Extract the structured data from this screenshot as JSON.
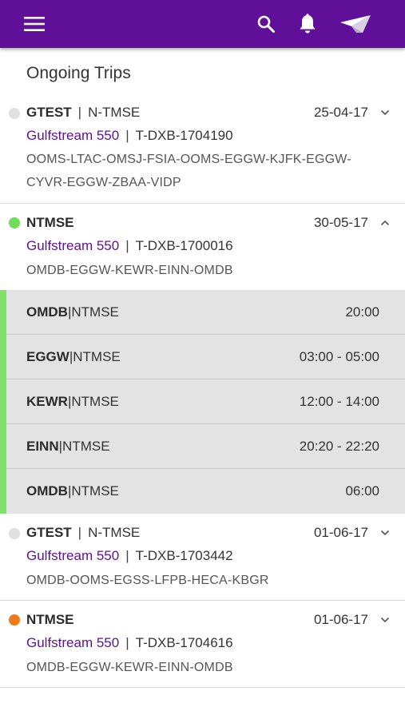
{
  "header": {
    "icons": [
      "menu-icon",
      "search-icon",
      "bell-icon",
      "paper-plane-icon"
    ],
    "background": "#5f0f98"
  },
  "section_title": "Ongoing Trips",
  "trips": [
    {
      "status_color": "#e0e0e0",
      "tail": "GTEST",
      "registration": "N-TMSE",
      "date": "25-04-17",
      "aircraft": "Gulfstream 550",
      "trip_id": "T-DXB-1704190",
      "route_line1": "OOMS-LTAC-OMSJ-FSIA-OOMS-EGGW-KJFK-EGGW-",
      "route_line2": "CYVR-EGGW-ZBAA-VIDP",
      "expanded": false
    },
    {
      "status_color": "#6fdc5a",
      "tail": "NTMSE",
      "registration": "",
      "date": "30-05-17",
      "aircraft": "Gulfstream 550",
      "trip_id": "T-DXB-1700016",
      "route_line1": "OMDB-EGGW-KEWR-EINN-OMDB",
      "expanded": true,
      "legs": [
        {
          "airport": "OMDB",
          "tail": "NTMSE",
          "time": "20:00"
        },
        {
          "airport": "EGGW",
          "tail": "NTMSE",
          "time": "03:00 - 05:00"
        },
        {
          "airport": "KEWR",
          "tail": "NTMSE",
          "time": "12:00 - 14:00"
        },
        {
          "airport": "EINN",
          "tail": "NTMSE",
          "time": "20:20 - 22:20"
        },
        {
          "airport": "OMDB",
          "tail": "NTMSE",
          "time": "06:00"
        }
      ]
    },
    {
      "status_color": "#e0e0e0",
      "tail": "GTEST",
      "registration": "N-TMSE",
      "date": "01-06-17",
      "aircraft": "Gulfstream 550",
      "trip_id": "T-DXB-1703442",
      "route_line1": "OMDB-OOMS-EGSS-LFPB-HECA-KBGR",
      "expanded": false
    },
    {
      "status_color": "#f07a1a",
      "tail": "NTMSE",
      "registration": "",
      "date": "01-06-17",
      "aircraft": "Gulfstream 550",
      "trip_id": "T-DXB-1704616",
      "route_line1": "OMDB-EGGW-KEWR-EINN-OMDB",
      "expanded": false
    }
  ],
  "separator": "|",
  "accent_color": "#5f0f98",
  "leg_bar_color": "#7fe36b"
}
